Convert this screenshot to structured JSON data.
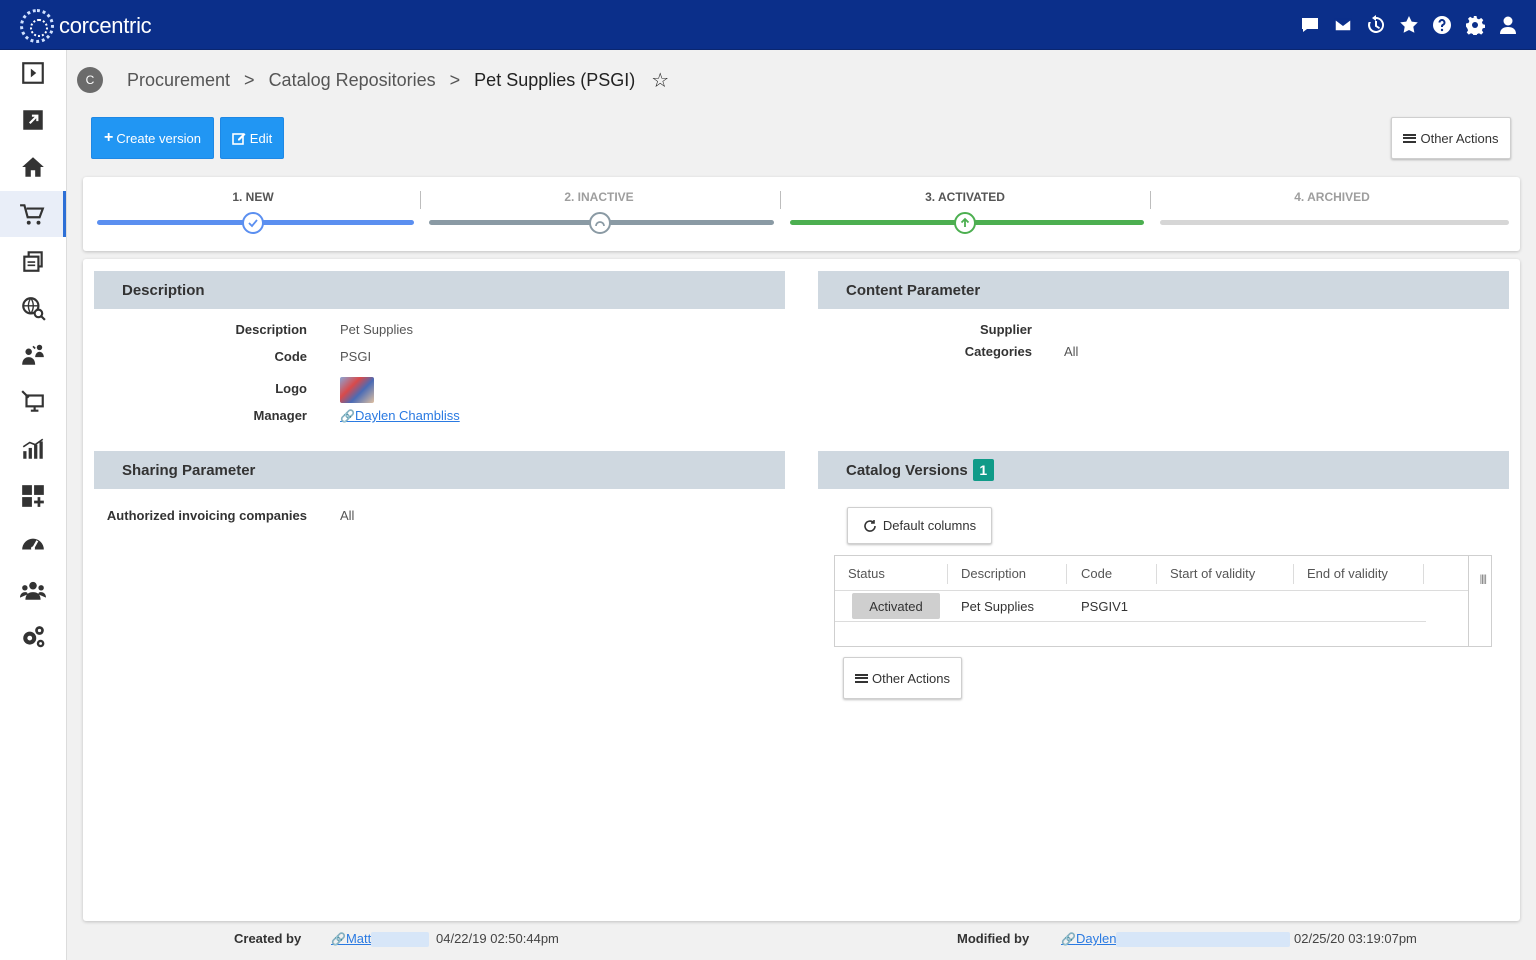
{
  "app": {
    "brand": "corcentric"
  },
  "header_icons": [
    "chat-icon",
    "mail-icon",
    "history-icon",
    "star-icon",
    "help-icon",
    "gear-icon",
    "user-icon"
  ],
  "sidebar": [
    {
      "name": "play-icon"
    },
    {
      "name": "external-link-icon"
    },
    {
      "name": "home-icon"
    },
    {
      "name": "cart-icon",
      "active": true
    },
    {
      "name": "documents-icon"
    },
    {
      "name": "global-search-icon"
    },
    {
      "name": "team-icon"
    },
    {
      "name": "monitor-icon"
    },
    {
      "name": "analytics-icon"
    },
    {
      "name": "add-widget-icon"
    },
    {
      "name": "dashboard-gauge-icon"
    },
    {
      "name": "users-icon"
    },
    {
      "name": "settings-gears-icon"
    }
  ],
  "breadcrumb": {
    "avatar": "C",
    "items": [
      "Procurement",
      "Catalog Repositories"
    ],
    "separator": ">",
    "current": "Pet Supplies (PSGI)"
  },
  "toolbar": {
    "create_version": "Create version",
    "edit": "Edit",
    "other_actions": "Other Actions"
  },
  "stepper": {
    "steps": [
      {
        "label": "1. NEW",
        "state": "done",
        "color": "#5b8ff0"
      },
      {
        "label": "2. INACTIVE",
        "state": "inactive",
        "color": "#8a9aa4"
      },
      {
        "label": "3. ACTIVATED",
        "state": "current",
        "color": "#4caf50"
      },
      {
        "label": "4. ARCHIVED",
        "state": "pending",
        "color": "#d6d6d6"
      }
    ]
  },
  "description_section": {
    "title": "Description",
    "fields": {
      "description_label": "Description",
      "description_value": "Pet Supplies",
      "code_label": "Code",
      "code_value": "PSGI",
      "logo_label": "Logo",
      "manager_label": "Manager",
      "manager_value": "Daylen Chambliss"
    }
  },
  "content_section": {
    "title": "Content Parameter",
    "supplier_label": "Supplier",
    "categories_label": "Categories",
    "categories_value": "All"
  },
  "sharing_section": {
    "title": "Sharing Parameter",
    "auth_label": "Authorized invoicing companies",
    "auth_value": "All"
  },
  "versions_section": {
    "title": "Catalog Versions",
    "count": "1",
    "default_columns": "Default columns",
    "other_actions": "Other Actions",
    "columns": [
      "Status",
      "Description",
      "Code",
      "Start of validity",
      "End of validity"
    ],
    "rows": [
      {
        "status": "Activated",
        "description": "Pet Supplies",
        "code": "PSGIV1",
        "start": "",
        "end": ""
      }
    ]
  },
  "footer": {
    "created_label": "Created by",
    "created_user": "Matt",
    "created_date": "04/22/19 02:50:44pm",
    "modified_label": "Modified by",
    "modified_user": "Daylen",
    "modified_date": "02/25/20 03:19:07pm"
  },
  "colors": {
    "topbar": "#0b2f8a",
    "primary": "#2196f3",
    "section": "#cfd8e0",
    "badge": "#109b88"
  }
}
